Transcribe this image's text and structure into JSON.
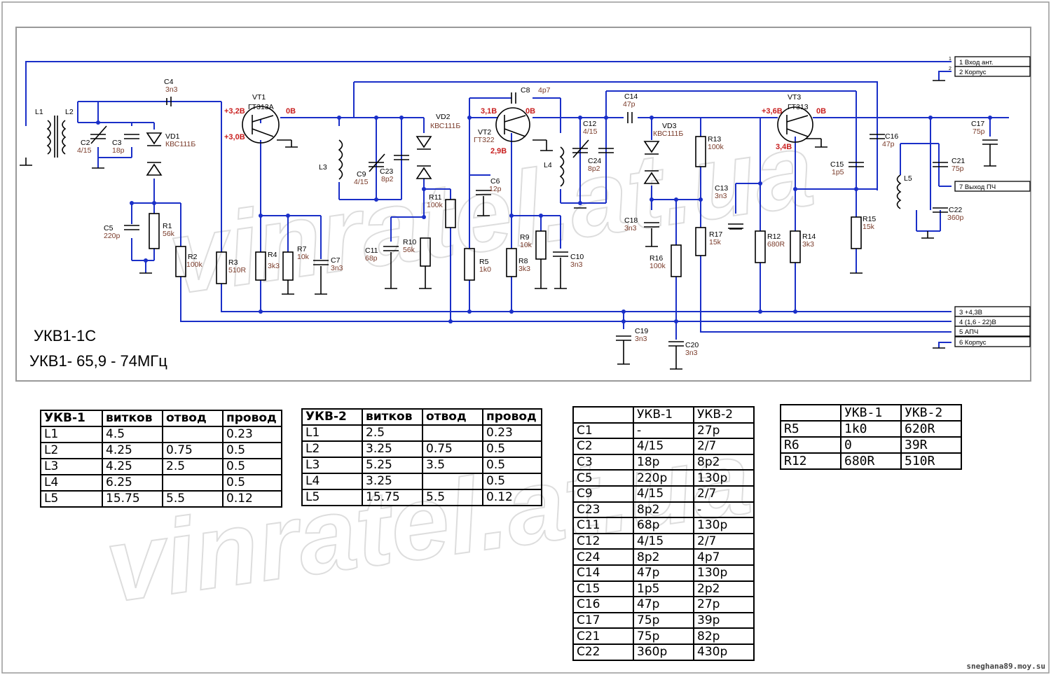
{
  "title_1": "УКВ1-1С",
  "title_2": "УКВ1- 65,9 - 74МГц",
  "watermark": "vinratel.at.ua",
  "credit": "sneghana89.moy.su",
  "connector": [
    {
      "pin": "1",
      "label": "1   Вход ант."
    },
    {
      "pin": "2",
      "label": "2   Корпус"
    },
    {
      "label": "7  Выход ПЧ"
    },
    {
      "label": "3  +4,3В"
    },
    {
      "label": "4  (1,6 - 22)В"
    },
    {
      "label": "5   АПЧ"
    },
    {
      "label": "6   Корпус"
    }
  ],
  "parts": {
    "L1": "L1",
    "L2": "L2",
    "C2": "C2",
    "C2v": "4/15",
    "C3": "C3",
    "C3v": "18p",
    "C4": "C4",
    "C4v": "3n3",
    "VD1": "VD1",
    "VD1v": "КВС111Б",
    "C5": "C5",
    "C5v": "220p",
    "R1": "R1",
    "R1v": "56k",
    "R2": "R2",
    "R2v": "100k",
    "R3": "R3",
    "R3v": "510R",
    "VT1": "VT1",
    "VT1v": "ГТ313А",
    "v32": "+3,2В",
    "v30": "+3,0В",
    "v0a": "0В",
    "R4": "R4",
    "R4v": "3k3",
    "R7": "R7",
    "R7v": "10k",
    "C7": "C7",
    "C7v": "3n3",
    "L3": "L3",
    "C9": "C9",
    "C9v": "4/15",
    "C23": "C23",
    "C23v": "8p2",
    "VD2": "VD2",
    "VD2v": "КВС111Б",
    "C11": "C11",
    "C11v": "68p",
    "R10": "R10",
    "R10v": "56k",
    "R11": "R11",
    "R11v": "100k",
    "C8": "C8",
    "C8v": "4p7",
    "VT2": "VT2",
    "VT2v": "ГТ322",
    "v31": "3,1В",
    "v0b": "0В",
    "v29": "2,9В",
    "C6": "C6",
    "C6v": "12p",
    "R5": "R5",
    "R5v": "1k0",
    "R8": "R8",
    "R8v": "3k3",
    "R9": "R9",
    "R9v": "10k",
    "C10": "C10",
    "C10v": "3n3",
    "L4": "L4",
    "C12": "C12",
    "C12v": "4/15",
    "C24": "C24",
    "C24v": "8p2",
    "C14": "C14",
    "C14v": "47p",
    "VD3": "VD3",
    "VD3v": "КВС111Б",
    "C13": "C13",
    "C13v": "3n3",
    "C18": "C18",
    "C18v": "3n3",
    "R16": "R16",
    "R16v": "100k",
    "R13": "R13",
    "R13v": "100k",
    "R17": "R17",
    "R17v": "15k",
    "VT3": "VT3",
    "VT3v": "ГТ313",
    "v36": "+3,6В",
    "v0c": "0В",
    "v34": "3,4В",
    "R12": "R12",
    "R12v": "680R",
    "R14": "R14",
    "R14v": "3k3",
    "R15": "R15",
    "R15v": "15k",
    "C15": "C15",
    "C15v": "1p5",
    "C16": "C16",
    "C16v": "47p",
    "L5": "L5",
    "C17": "C17",
    "C17v": "75p",
    "C21": "C21",
    "C21v": "75p",
    "C22": "C22",
    "C22v": "360p",
    "C19": "C19",
    "C19v": "3n3",
    "C20": "C20",
    "C20v": "3n3"
  },
  "table_ukv1": {
    "header": [
      "УКВ-1",
      "витков",
      "отвод",
      "провод"
    ],
    "rows": [
      [
        "L1",
        "4.5",
        "",
        "0.23"
      ],
      [
        "L2",
        "4.25",
        "0.75",
        "0.5"
      ],
      [
        "L3",
        "4.25",
        "2.5",
        "0.5"
      ],
      [
        "L4",
        "6.25",
        "",
        "0.5"
      ],
      [
        "L5",
        "15.75",
        "5.5",
        "0.12"
      ]
    ]
  },
  "table_ukv2": {
    "header": [
      "УКВ-2",
      "витков",
      "отвод",
      "провод"
    ],
    "rows": [
      [
        "L1",
        "2.5",
        "",
        "0.23"
      ],
      [
        "L2",
        "3.25",
        "0.75",
        "0.5"
      ],
      [
        "L3",
        "5.25",
        "3.5",
        "0.5"
      ],
      [
        "L4",
        "3.25",
        "",
        "0.5"
      ],
      [
        "L5",
        "15.75",
        "5.5",
        "0.12"
      ]
    ]
  },
  "table_caps": {
    "header": [
      "",
      "УКВ-1",
      "УКВ-2"
    ],
    "rows": [
      [
        "C1",
        "-",
        "27p"
      ],
      [
        "C2",
        "4/15",
        "2/7"
      ],
      [
        "C3",
        "18p",
        "8p2"
      ],
      [
        "C5",
        "220p",
        "130p"
      ],
      [
        "C9",
        "4/15",
        "2/7"
      ],
      [
        "C23",
        "8p2",
        "-"
      ],
      [
        "C11",
        "68p",
        "130p"
      ],
      [
        "C12",
        "4/15",
        "2/7"
      ],
      [
        "C24",
        "8p2",
        "4p7"
      ],
      [
        "C14",
        "47p",
        "130p"
      ],
      [
        "C15",
        "1p5",
        "2p2"
      ],
      [
        "C16",
        "47p",
        "27p"
      ],
      [
        "C17",
        "75p",
        "39p"
      ],
      [
        "C21",
        "75p",
        "82p"
      ],
      [
        "C22",
        "360p",
        "430p"
      ]
    ]
  },
  "table_res": {
    "header": [
      "",
      "УКВ-1",
      "УКВ-2"
    ],
    "rows": [
      [
        "R5",
        "1k0",
        "620R"
      ],
      [
        "R6",
        "0",
        "39R"
      ],
      [
        "R12",
        "680R",
        "510R"
      ]
    ]
  }
}
